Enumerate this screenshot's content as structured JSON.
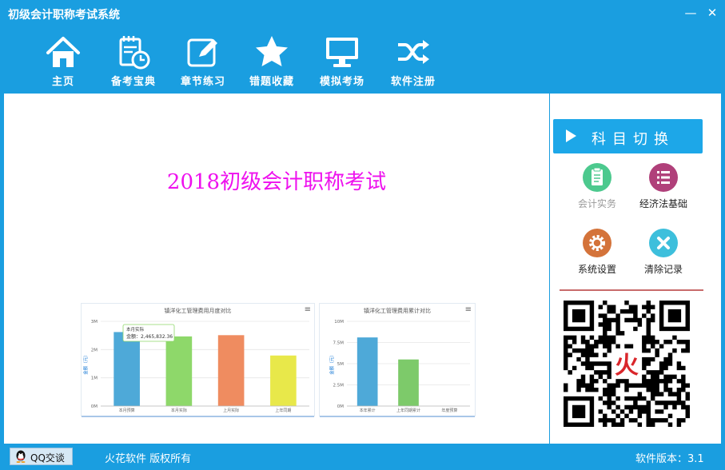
{
  "window": {
    "title": "初级会计职称考试系统",
    "minimize_label": "—",
    "close_label": "✕"
  },
  "toolbar": {
    "items": [
      {
        "label": "主页",
        "icon": "home-icon"
      },
      {
        "label": "备考宝典",
        "icon": "notebook-clock-icon"
      },
      {
        "label": "章节练习",
        "icon": "edit-icon"
      },
      {
        "label": "错题收藏",
        "icon": "star-icon"
      },
      {
        "label": "模拟考场",
        "icon": "monitor-icon"
      },
      {
        "label": "软件注册",
        "icon": "shuffle-icon"
      }
    ]
  },
  "main": {
    "heading": "2018初级会计职称考试"
  },
  "charts": [
    {
      "title": "镇洋化工管理费用月度对比",
      "ylabel": "金额（元）",
      "yticks": [
        "0M",
        "1M",
        "2M",
        "3M"
      ],
      "tooltip_title": "本月实际",
      "tooltip_value": "金额：2,465,832.36"
    },
    {
      "title": "镇洋化工管理费用累计对比",
      "ylabel": "金额（元）",
      "yticks": [
        "0M",
        "2.5M",
        "5M",
        "7.5M",
        "10M"
      ]
    }
  ],
  "chart_data": [
    {
      "type": "bar",
      "title": "镇洋化工管理费用月度对比",
      "ylabel": "金额（元）",
      "categories": [
        "本月预算",
        "本月实际",
        "上月实际",
        "上年同期"
      ],
      "values": [
        2620000,
        2465832.36,
        2510000,
        1790000
      ],
      "colors": [
        "#4ea9d8",
        "#8ed86a",
        "#ef8c60",
        "#e8e84a"
      ],
      "ylim": [
        0,
        3000000
      ]
    },
    {
      "type": "bar",
      "title": "镇洋化工管理费用累计对比",
      "ylabel": "金额（元）",
      "categories": [
        "本年累计",
        "上年同期累计",
        "年度预算"
      ],
      "values": [
        8100000,
        5500000,
        0
      ],
      "colors": [
        "#4ea9d8",
        "#7dca6a",
        "#e8e84a"
      ],
      "ylim": [
        0,
        10000000
      ]
    }
  ],
  "side": {
    "switch_label": "科目切换",
    "subjects": [
      {
        "label": "会计实务",
        "icon": "clipboard-icon",
        "color": "#4cc98e"
      },
      {
        "label": "经济法基础",
        "icon": "list-icon",
        "color": "#b0407a"
      },
      {
        "label": "系统设置",
        "icon": "gear-icon",
        "color": "#d4733a"
      },
      {
        "label": "清除记录",
        "icon": "close-icon",
        "color": "#3dbfdc"
      }
    ],
    "qr_logo": "火"
  },
  "statusbar": {
    "qq_label": "QQ交谈",
    "copyright": "火花软件 版权所有",
    "version": "软件版本：3.1"
  },
  "colors": {
    "frame": "#1a9ee0",
    "heading": "#ee11ee",
    "switch": "#1da7e8"
  }
}
